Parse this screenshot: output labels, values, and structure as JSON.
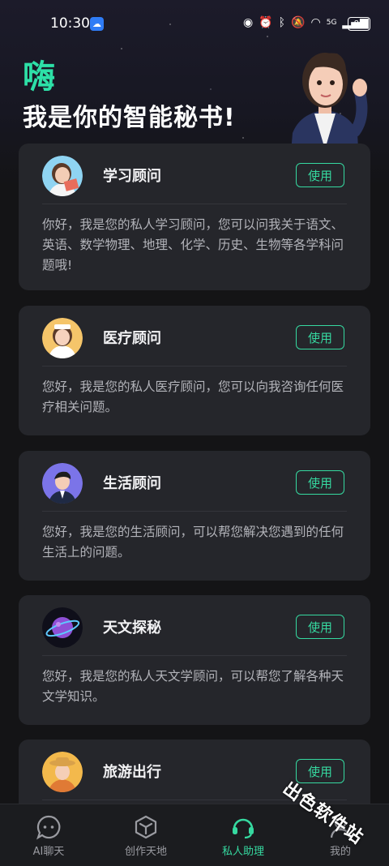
{
  "status_bar": {
    "time": "10:30",
    "network": "5G",
    "battery": "80",
    "icons": [
      "weather-app-icon",
      "eye-icon",
      "alarm-icon",
      "bluetooth-icon",
      "mute-icon",
      "wifi-icon",
      "signal-icon",
      "battery-icon"
    ]
  },
  "hero": {
    "hi": "嗨",
    "title": "我是你的智能秘书!"
  },
  "assistants": [
    {
      "name": "学习顾问",
      "button": "使用",
      "desc": "你好，我是您的私人学习顾问，您可以问我关于语文、英语、数学物理、地理、化学、历史、生物等各学科问题哦!",
      "icon": "student-avatar-icon"
    },
    {
      "name": "医疗顾问",
      "button": "使用",
      "desc": "您好，我是您的私人医疗顾问，您可以向我咨询任何医疗相关问题。",
      "icon": "nurse-avatar-icon"
    },
    {
      "name": "生活顾问",
      "button": "使用",
      "desc": "您好，我是您的生活顾问，可以帮您解决您遇到的任何生活上的问题。",
      "icon": "man-avatar-icon"
    },
    {
      "name": "天文探秘",
      "button": "使用",
      "desc": "您好，我是您的私人天文学顾问，可以帮您了解各种天文学知识。",
      "icon": "planet-icon"
    },
    {
      "name": "旅游出行",
      "button": "使用",
      "desc": "",
      "icon": "traveler-avatar-icon"
    }
  ],
  "tabs": [
    {
      "label": "AI聊天",
      "icon": "chat-bubble-icon",
      "active": false
    },
    {
      "label": "创作天地",
      "icon": "cube-icon",
      "active": false
    },
    {
      "label": "私人助理",
      "icon": "headset-icon",
      "active": true
    },
    {
      "label": "我的",
      "icon": "person-icon",
      "active": false
    }
  ],
  "watermark": "出色软件站",
  "colors": {
    "accent": "#36d9a0",
    "background": "#141416",
    "card": "#25262b"
  }
}
